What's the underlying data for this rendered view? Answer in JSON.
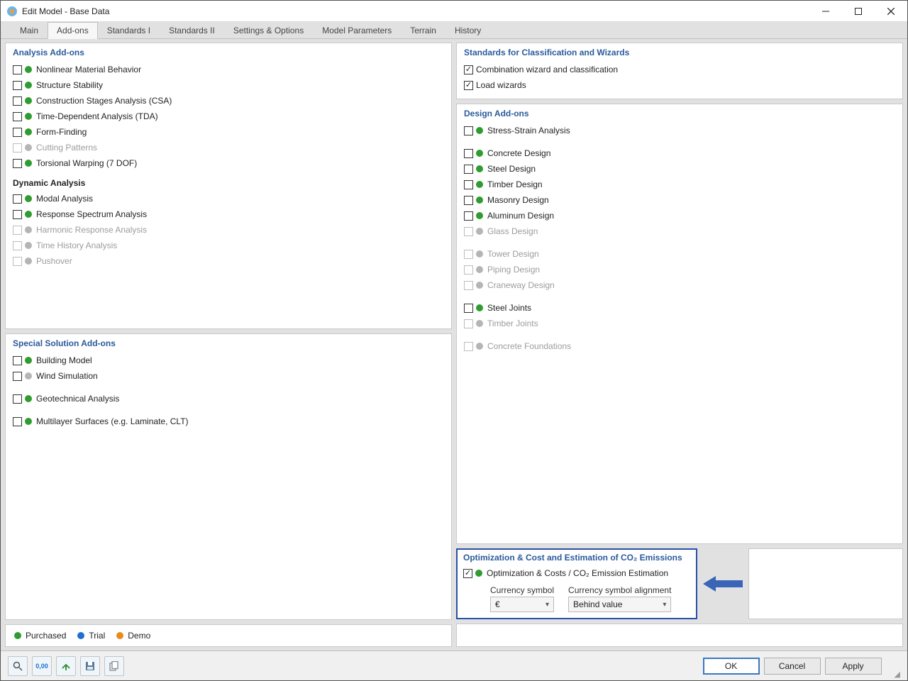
{
  "window": {
    "title": "Edit Model - Base Data"
  },
  "tabs": [
    "Main",
    "Add-ons",
    "Standards I",
    "Standards II",
    "Settings & Options",
    "Model Parameters",
    "Terrain",
    "History"
  ],
  "tabs_active": 1,
  "panels": {
    "analysis": {
      "title": "Analysis Add-ons",
      "items": [
        {
          "label": "Nonlinear Material Behavior",
          "dot": "green"
        },
        {
          "label": "Structure Stability",
          "dot": "green"
        },
        {
          "label": "Construction Stages Analysis (CSA)",
          "dot": "green"
        },
        {
          "label": "Time-Dependent Analysis (TDA)",
          "dot": "green"
        },
        {
          "label": "Form-Finding",
          "dot": "green"
        },
        {
          "label": "Cutting Patterns",
          "dot": "gray",
          "disabled": true
        },
        {
          "label": "Torsional Warping (7 DOF)",
          "dot": "green"
        }
      ],
      "dyn_title": "Dynamic Analysis",
      "dyn_items": [
        {
          "label": "Modal Analysis",
          "dot": "green"
        },
        {
          "label": "Response Spectrum Analysis",
          "dot": "green"
        },
        {
          "label": "Harmonic Response Analysis",
          "dot": "gray",
          "disabled": true
        },
        {
          "label": "Time History Analysis",
          "dot": "gray",
          "disabled": true
        },
        {
          "label": "Pushover",
          "dot": "gray",
          "disabled": true
        }
      ]
    },
    "special": {
      "title": "Special Solution Add-ons",
      "items": [
        {
          "label": "Building Model",
          "dot": "green"
        },
        {
          "label": "Wind Simulation",
          "dot": "gray",
          "space": false
        },
        {
          "label": "Geotechnical Analysis",
          "dot": "green",
          "space": true
        },
        {
          "label": "Multilayer Surfaces (e.g. Laminate, CLT)",
          "dot": "green",
          "space": true
        }
      ]
    },
    "standards_class": {
      "title": "Standards for Classification and Wizards",
      "items": [
        {
          "label": "Combination wizard and classification",
          "checked": true
        },
        {
          "label": "Load wizards",
          "checked": true
        }
      ]
    },
    "design": {
      "title": "Design Add-ons",
      "items": [
        {
          "label": "Stress-Strain Analysis",
          "dot": "green",
          "space": false
        },
        {
          "label": "Concrete Design",
          "dot": "green",
          "space": true
        },
        {
          "label": "Steel Design",
          "dot": "green"
        },
        {
          "label": "Timber Design",
          "dot": "green"
        },
        {
          "label": "Masonry Design",
          "dot": "green"
        },
        {
          "label": "Aluminum Design",
          "dot": "green"
        },
        {
          "label": "Glass Design",
          "dot": "gray",
          "disabled": true
        },
        {
          "label": "Tower Design",
          "dot": "gray",
          "disabled": true,
          "space": true
        },
        {
          "label": "Piping Design",
          "dot": "gray",
          "disabled": true
        },
        {
          "label": "Craneway Design",
          "dot": "gray",
          "disabled": true
        },
        {
          "label": "Steel Joints",
          "dot": "green",
          "space": true
        },
        {
          "label": "Timber Joints",
          "dot": "gray",
          "disabled": true
        },
        {
          "label": "Concrete Foundations",
          "dot": "gray",
          "disabled": true,
          "space": true
        }
      ]
    },
    "optimization": {
      "title": "Optimization & Cost and Estimation of CO₂ Emissions",
      "item": {
        "label": "Optimization & Costs / CO₂ Emission Estimation",
        "dot": "green",
        "checked": true
      },
      "currency_label": "Currency symbol",
      "currency_value": "€",
      "align_label": "Currency symbol alignment",
      "align_value": "Behind value"
    }
  },
  "legend": {
    "purchased": "Purchased",
    "trial": "Trial",
    "demo": "Demo"
  },
  "buttons": {
    "ok": "OK",
    "cancel": "Cancel",
    "apply": "Apply"
  }
}
